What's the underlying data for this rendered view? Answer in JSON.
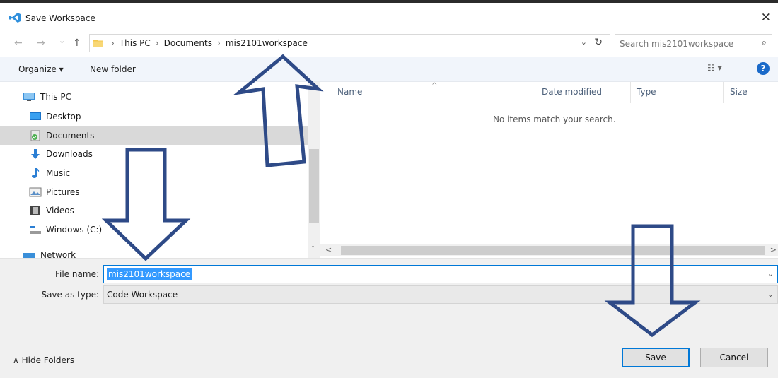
{
  "window": {
    "title": "Save Workspace",
    "close_glyph": "✕",
    "icon": "vscode-icon"
  },
  "addressbar": {
    "back_glyph": "←",
    "forward_glyph": "→",
    "recent_glyph": "⌄",
    "up_glyph": "↑",
    "crumbs": [
      "This PC",
      "Documents",
      "mis2101workspace"
    ],
    "crumb_sep": "›",
    "dropdown_glyph": "⌄",
    "refresh_glyph": "↻"
  },
  "search": {
    "placeholder": "Search mis2101workspace",
    "icon_glyph": "⌕"
  },
  "toolbar": {
    "organize_label": "Organize ▾",
    "new_folder_label": "New folder",
    "view_glyph": "☷ ▾",
    "help_glyph": "?"
  },
  "nav": {
    "items": [
      {
        "label": "This PC",
        "icon": "this-pc-icon",
        "selected": false
      },
      {
        "label": "Desktop",
        "icon": "desktop-icon",
        "selected": false
      },
      {
        "label": "Documents",
        "icon": "documents-icon",
        "selected": true
      },
      {
        "label": "Downloads",
        "icon": "downloads-icon",
        "selected": false
      },
      {
        "label": "Music",
        "icon": "music-icon",
        "selected": false
      },
      {
        "label": "Pictures",
        "icon": "pictures-icon",
        "selected": false
      },
      {
        "label": "Videos",
        "icon": "videos-icon",
        "selected": false
      },
      {
        "label": "Windows (C:)",
        "icon": "drive-icon",
        "selected": false
      },
      {
        "label": "Network",
        "icon": "network-icon",
        "selected": false
      }
    ],
    "scroll_up_glyph": "˄",
    "scroll_down_glyph": "˅"
  },
  "files": {
    "columns": [
      "Name",
      "Date modified",
      "Type",
      "Size"
    ],
    "sort_glyph": "^",
    "empty_message": "No items match your search.",
    "scroll_left_glyph": "<",
    "scroll_right_glyph": ">"
  },
  "form": {
    "file_name_label": "File name:",
    "file_name_value": "mis2101workspace",
    "save_type_label": "Save as type:",
    "save_type_value": "Code Workspace",
    "dropdown_glyph": "⌄"
  },
  "footer": {
    "hide_folders_label": "∧  Hide Folders",
    "save_label": "Save",
    "cancel_label": "Cancel"
  },
  "colors": {
    "annotation_arrow": "#2e4a87",
    "accent": "#0078d7",
    "selection": "#3399ff",
    "command_bar": "#f1f5fb",
    "nav_selected": "#d9d9d9"
  }
}
